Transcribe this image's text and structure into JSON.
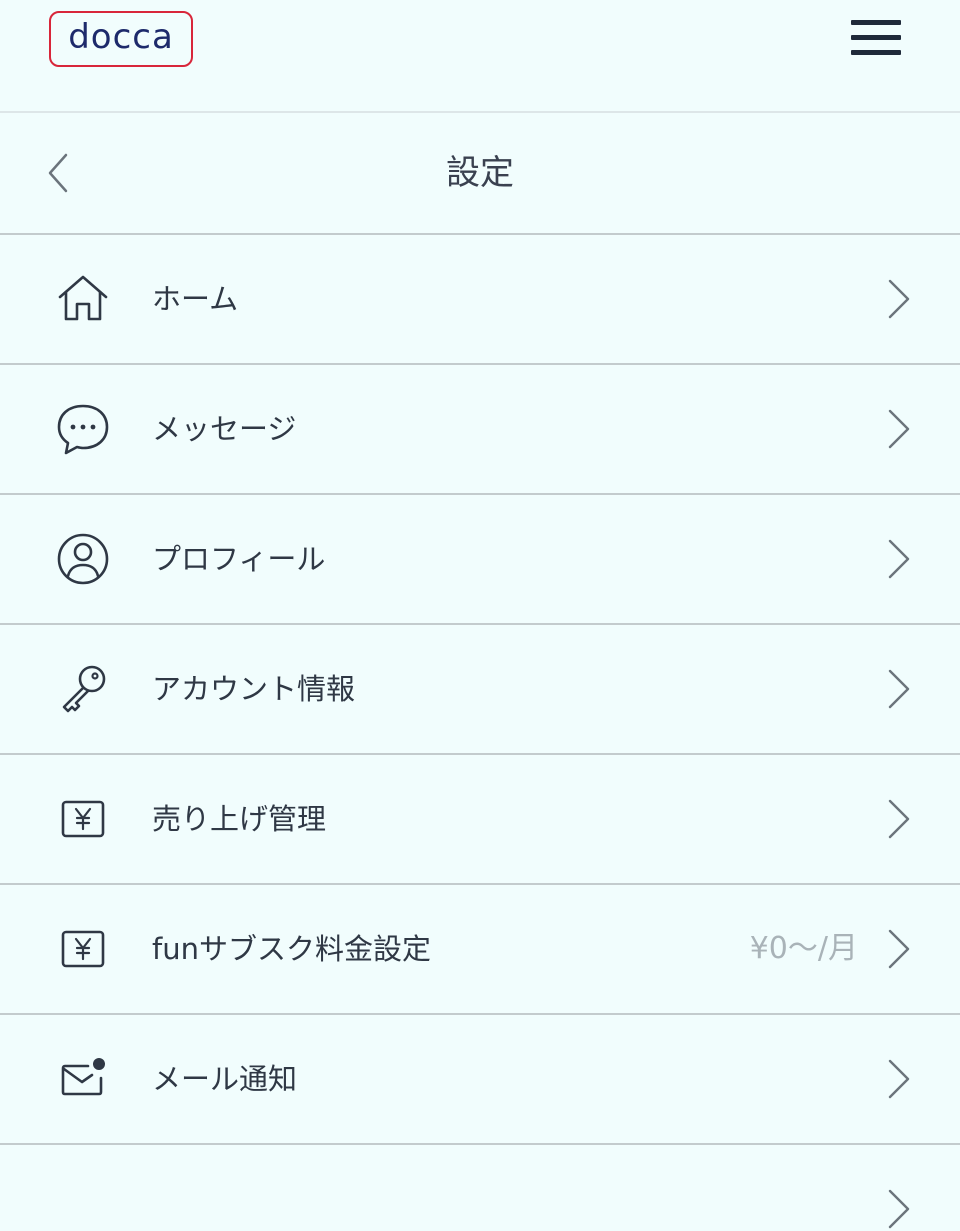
{
  "header": {
    "logo_text": "docca",
    "menu_icon": "hamburger-menu-icon"
  },
  "titlebar": {
    "title": "設定",
    "back_icon": "chevron-left-icon"
  },
  "menu": {
    "items": [
      {
        "label": "ホーム",
        "icon": "home-icon",
        "value": ""
      },
      {
        "label": "メッセージ",
        "icon": "chat-bubble-icon",
        "value": ""
      },
      {
        "label": "プロフィール",
        "icon": "user-circle-icon",
        "value": ""
      },
      {
        "label": "アカウント情報",
        "icon": "key-icon",
        "value": ""
      },
      {
        "label": "売り上げ管理",
        "icon": "yen-icon",
        "value": ""
      },
      {
        "label": "funサブスク料金設定",
        "icon": "yen-icon",
        "value": "¥0〜/月"
      },
      {
        "label": "メール通知",
        "icon": "mail-notification-icon",
        "value": ""
      }
    ]
  },
  "colors": {
    "background": "#f1fdfd",
    "logo_border": "#d8263a",
    "logo_text": "#1d2a6b",
    "text": "#2f3845",
    "muted": "#a9b3b8",
    "divider": "#c3cbcd"
  }
}
